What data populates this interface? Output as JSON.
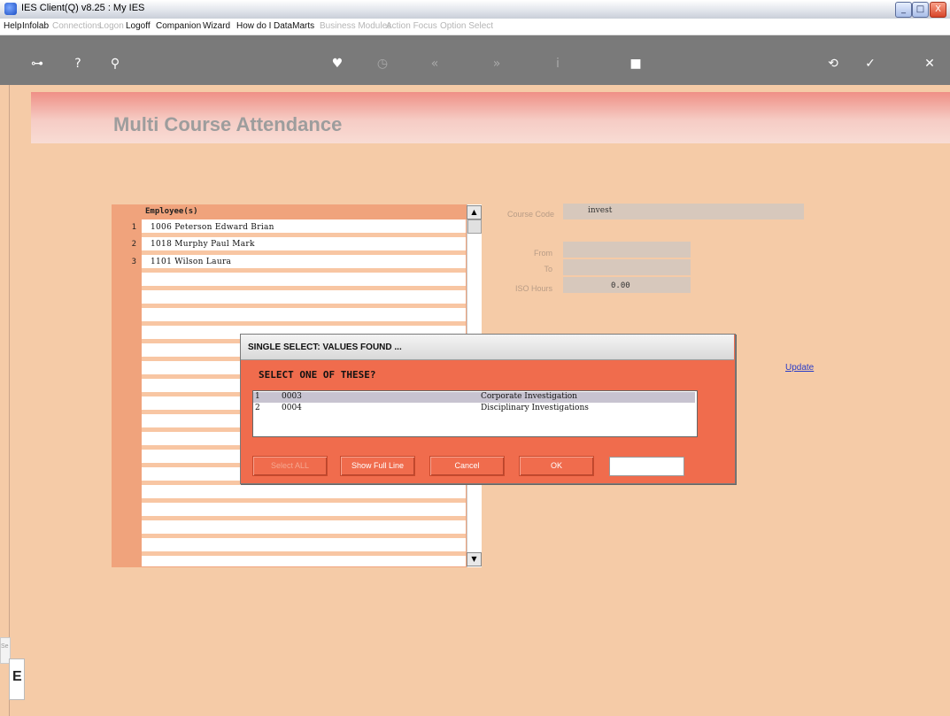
{
  "window": {
    "title": "IES Client(Q) v8.25 : My IES",
    "min": "_",
    "max": "□",
    "close": "X"
  },
  "menu": [
    {
      "label": "Help",
      "enabled": true
    },
    {
      "label": "Infolab",
      "enabled": true
    },
    {
      "label": "Connections",
      "enabled": false
    },
    {
      "label": "Logon",
      "enabled": false
    },
    {
      "label": "Logoff",
      "enabled": true
    },
    {
      "label": "Companion",
      "enabled": true
    },
    {
      "label": "Wizard",
      "enabled": true
    },
    {
      "label": "How do I",
      "enabled": true
    },
    {
      "label": "DataMarts",
      "enabled": true
    },
    {
      "label": "Business Modules",
      "enabled": false
    },
    {
      "label": "Action Focus",
      "enabled": false
    },
    {
      "label": "Option Select",
      "enabled": false
    }
  ],
  "toolbar": {
    "key": "⊶",
    "help": "?",
    "search": "⚲",
    "heart": "♥",
    "clock": "◷",
    "prev": "«",
    "next": "»",
    "info": "i",
    "stop": "■",
    "refresh": "⟲",
    "check": "✓",
    "close": "✕"
  },
  "page": {
    "title": "Multi Course Attendance"
  },
  "employees": {
    "header": "Employee(s)",
    "rows": [
      {
        "num": "1",
        "text": "1006 Peterson Edward Brian"
      },
      {
        "num": "2",
        "text": "1018 Murphy Paul Mark"
      },
      {
        "num": "3",
        "text": "1101 Wilson Laura"
      }
    ],
    "scroll_up": "▲",
    "scroll_down": "▼"
  },
  "fields": {
    "course_code_label": "Course Code",
    "course_code_value": "invest",
    "from_label": "From",
    "to_label": "To",
    "iso_label": "ISO Hours",
    "iso_value": "0.00",
    "update_link": "Update"
  },
  "dialog": {
    "title": "SINGLE SELECT: VALUES FOUND ...",
    "prompt": "SELECT ONE OF THESE?",
    "rows": [
      {
        "num": "1",
        "code": "0003",
        "desc": "Corporate Investigation",
        "selected": true
      },
      {
        "num": "2",
        "code": "0004",
        "desc": "Disciplinary Investigations",
        "selected": false
      }
    ],
    "buttons": {
      "select_all": "Select ALL",
      "show_full": "Show Full Line",
      "cancel": "Cancel",
      "ok": "OK"
    },
    "input_value": ""
  },
  "bottom_left": {
    "text": "Se",
    "char": "E"
  },
  "colors": {
    "background": "#f5cba7",
    "dialog": "#f06c4d",
    "link": "#2a3cc7",
    "toolbar": "#7a7a7a"
  }
}
